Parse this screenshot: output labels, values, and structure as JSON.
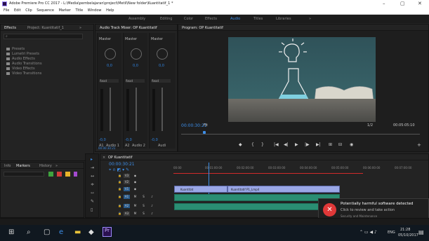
{
  "window": {
    "title": "Adobe Premiere Pro CC 2017 - L:\\Media\\pembelajaran\\project\\Metil\\New folder\\Kuantitatif_1 *",
    "controls": [
      "–",
      "▢",
      "✕"
    ]
  },
  "menu": [
    "File",
    "Edit",
    "Clip",
    "Sequence",
    "Marker",
    "Title",
    "Window",
    "Help"
  ],
  "workspaces": {
    "items": [
      "Assembly",
      "Editing",
      "Color",
      "Effects",
      "Audio",
      "Titles",
      "Libraries"
    ],
    "active": "Audio",
    "more": "»"
  },
  "effects_panel": {
    "tabs": [
      "Effects",
      "Project: Kuantitatif_1"
    ],
    "more": "»",
    "items": [
      "Presets",
      "Lumetri Presets",
      "Audio Effects",
      "Audio Transitions",
      "Video Effects",
      "Video Transitions"
    ]
  },
  "audio_mixer": {
    "title": "Audio Track Mixer: OP Kuantitatif",
    "channels": [
      {
        "name": "Master",
        "value": "0,0",
        "mode": "Read",
        "track": "A1",
        "label": "Audio 1",
        "meter": "-0,0"
      },
      {
        "name": "Master",
        "value": "0,0",
        "mode": "Read",
        "track": "A2",
        "label": "Audio 2",
        "meter": "-0,0"
      },
      {
        "name": "Master",
        "value": "0,0",
        "mode": "Read",
        "track": "",
        "label": "Audi",
        "meter": "-0,0"
      }
    ],
    "timecode": "00:00:30:21"
  },
  "program_monitor": {
    "title": "Program: OP Kuantitatif",
    "timecode": "00:00:30:21",
    "fit": "Fit",
    "resolution": "1/2",
    "duration": "00:05:05:10",
    "transport": [
      "◆",
      "{",
      "}",
      "|◀",
      "◀|",
      "▶",
      "|▶",
      "▶|",
      "⊞",
      "⊟",
      "◉"
    ]
  },
  "markers_panel": {
    "tabs": [
      "Info",
      "Markers",
      "History"
    ],
    "more": "»",
    "colors": [
      "#3ea33e",
      "#d23a3a",
      "#e8b32a",
      "#a44ad0"
    ]
  },
  "timeline": {
    "title": "OP Kuantitatif",
    "timecode": "00:00:30:21",
    "ruler": [
      "00:00",
      "00:01:00:00",
      "00:02:00:00",
      "00:03:00:00",
      "00:04:00:00",
      "00:05:00:00",
      "00:06:00:00",
      "00:07:00:00"
    ],
    "tracks": [
      {
        "id": "V3",
        "type": "video"
      },
      {
        "id": "V2",
        "type": "video"
      },
      {
        "id": "V1",
        "type": "video"
      },
      {
        "id": "A1",
        "type": "audio"
      },
      {
        "id": "A2",
        "type": "audio"
      },
      {
        "id": "A3",
        "type": "audio"
      }
    ],
    "clips": {
      "video_1": "Kuantitat",
      "video_2": "Kuantitatif P1_Lmp4"
    }
  },
  "notification": {
    "title": "Potentially harmful software detected",
    "body": "Click to review and take action",
    "source": "Security and Maintenance"
  },
  "taskbar": {
    "time": "21:28",
    "date": "05/10/2017",
    "lang": "ENG"
  }
}
